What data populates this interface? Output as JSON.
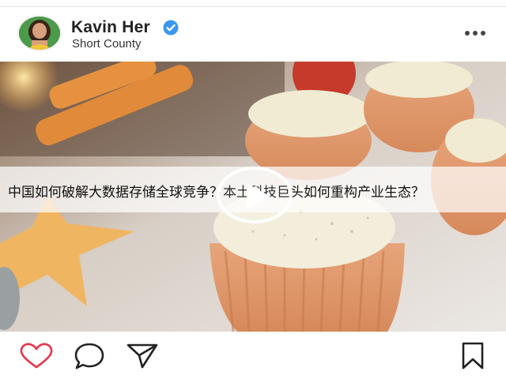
{
  "post": {
    "username": "Kavin Her",
    "location": "Short County",
    "verified_color": "#3897f0",
    "media": {
      "type": "video",
      "caption": "中国如何破解大数据存储全球竞争？本土科技巨头如何重构产业生态？"
    }
  },
  "icons": {
    "more": "more-options-icon",
    "like": "heart-icon",
    "comment": "comment-icon",
    "share": "send-icon",
    "save": "bookmark-icon",
    "play": "play-icon"
  }
}
